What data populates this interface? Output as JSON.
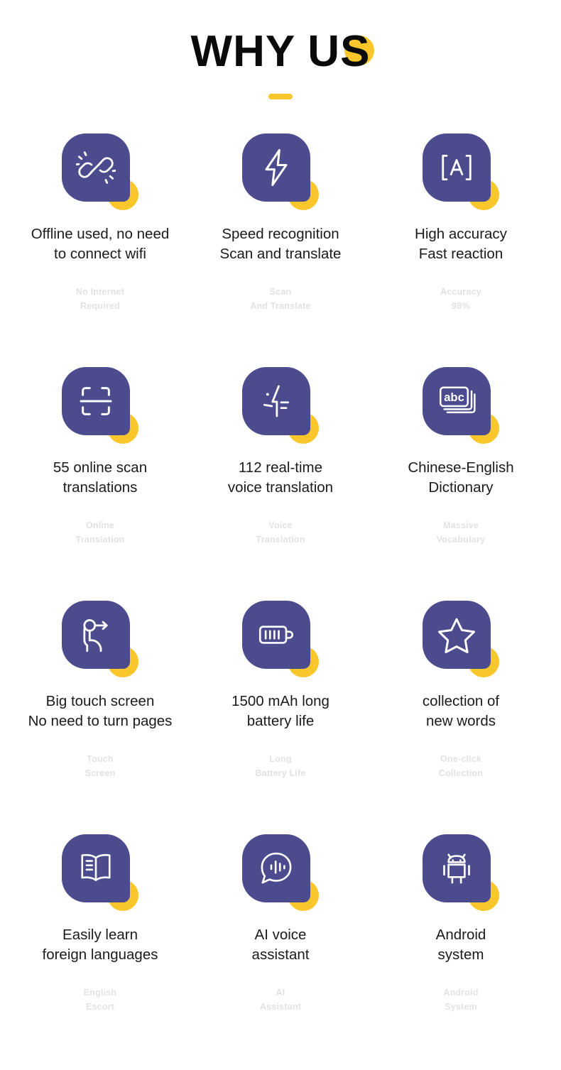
{
  "header": {
    "title": "WHY US",
    "accent_dot_color": "#F9C62C",
    "underline_color": "#F9C62C",
    "title_color": "#0A0A0A"
  },
  "theme": {
    "tile_color": "#4B4B8E",
    "accent_color": "#F9C62C",
    "title_text_color": "#1B1B1B",
    "subtitle_text_color": "#E2E2E2",
    "background": "#FFFFFF"
  },
  "features": [
    {
      "icon": "broken-link-offline-icon",
      "title": "Offline used, no need\nto connect wifi",
      "subtitle": "No Internet\nRequired"
    },
    {
      "icon": "lightning-bolt-icon",
      "title": "Speed recognition\nScan and translate",
      "subtitle": "Scan\nAnd Translate"
    },
    {
      "icon": "letter-a-brackets-icon",
      "title": "High accuracy\nFast reaction",
      "subtitle": "Accuracy\n98%"
    },
    {
      "icon": "scan-frame-icon",
      "title": "55 online scan\ntranslations",
      "subtitle": "Online\nTranslation"
    },
    {
      "icon": "voice-profile-icon",
      "title": "112 real-time\nvoice translation",
      "subtitle": "Voice\nTranslation"
    },
    {
      "icon": "abc-cards-icon",
      "title": "Chinese-English\nDictionary",
      "subtitle": "Massive\nVocabulary"
    },
    {
      "icon": "touch-swipe-hand-icon",
      "title": "Big touch screen\nNo need to turn pages",
      "subtitle": "Touch\nScreen"
    },
    {
      "icon": "battery-full-icon",
      "title": "1500 mAh long\nbattery life",
      "subtitle": "Long\nBattery Life"
    },
    {
      "icon": "star-icon",
      "title": "collection of\nnew words",
      "subtitle": "One-click\nCollection"
    },
    {
      "icon": "open-book-icon",
      "title": "Easily learn\nforeign languages",
      "subtitle": "English\nEscort"
    },
    {
      "icon": "voice-chat-bubble-icon",
      "title": "AI voice\nassistant",
      "subtitle": "AI\nAssistant"
    },
    {
      "icon": "android-robot-icon",
      "title": "Android\nsystem",
      "subtitle": "Android\nSystem"
    }
  ]
}
